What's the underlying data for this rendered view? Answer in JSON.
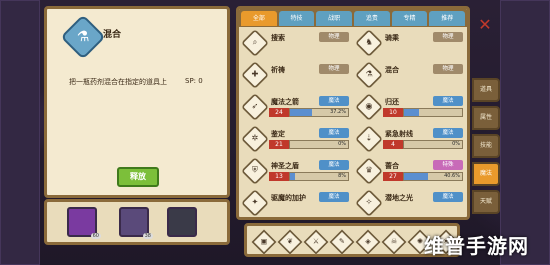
{
  "detail": {
    "title": "混合",
    "icon": "flask-icon",
    "description": "把一瓶药剂混合在指定的道具上",
    "sp": "SP: 0",
    "release_label": "释放"
  },
  "slots": [
    {
      "badge": "60",
      "color": "#7a3aa0"
    },
    {
      "badge": "38",
      "color": "#5a4a7a"
    },
    {
      "badge": "",
      "color": "#3a3a48"
    }
  ],
  "tabs": [
    "全部",
    "特技",
    "战职",
    "追责",
    "专精",
    "推荐"
  ],
  "skills": [
    {
      "name": "搜索",
      "type": "物理",
      "type_class": "phys",
      "icon": "search-icon",
      "glyph": "⌕"
    },
    {
      "name": "骑乘",
      "type": "物理",
      "type_class": "phys",
      "icon": "horse-icon",
      "glyph": "♞"
    },
    {
      "name": "祈祷",
      "type": "物理",
      "type_class": "phys",
      "icon": "pray-icon",
      "glyph": "✚"
    },
    {
      "name": "混合",
      "type": "物理",
      "type_class": "phys",
      "icon": "flask-icon",
      "glyph": "⚗"
    },
    {
      "name": "魔法之箭",
      "type": "魔法",
      "type_class": "magic",
      "level": "24",
      "pct": "37.2%",
      "progress": 0.372,
      "icon": "arrow-icon",
      "glyph": "➶"
    },
    {
      "name": "归还",
      "type": "魔法",
      "type_class": "magic",
      "level": "10",
      "pct": "",
      "progress": 0.25,
      "icon": "portal-icon",
      "glyph": "◉"
    },
    {
      "name": "鉴定",
      "type": "魔法",
      "type_class": "magic",
      "level": "21",
      "pct": "0%",
      "progress": 0.0,
      "icon": "identify-icon",
      "glyph": "✲"
    },
    {
      "name": "紧急射线",
      "type": "魔法",
      "type_class": "magic",
      "level": "4",
      "pct": "0%",
      "progress": 0.0,
      "icon": "ray-icon",
      "glyph": "⇣"
    },
    {
      "name": "神圣之盾",
      "type": "魔法",
      "type_class": "magic",
      "level": "13",
      "pct": "8%",
      "progress": 0.08,
      "icon": "shield-icon",
      "glyph": "⛨"
    },
    {
      "name": "蔷合",
      "type": "特殊",
      "type_class": "holy",
      "level": "27",
      "pct": "40.6%",
      "progress": 0.406,
      "icon": "crown-icon",
      "glyph": "♛"
    },
    {
      "name": "驱魔的加护",
      "type": "魔法",
      "type_class": "magic",
      "icon": "ward-icon",
      "glyph": "✦"
    },
    {
      "name": "潜地之光",
      "type": "魔法",
      "type_class": "magic",
      "icon": "light-icon",
      "glyph": "✧"
    }
  ],
  "side_tabs": [
    {
      "label": "道具",
      "active": false
    },
    {
      "label": "属性",
      "active": false
    },
    {
      "label": "技能",
      "active": false
    },
    {
      "label": "魔法",
      "active": true
    },
    {
      "label": "天赋",
      "active": false
    }
  ],
  "actions": [
    {
      "icon": "slot-icon",
      "glyph": "▣"
    },
    {
      "icon": "leaf-icon",
      "glyph": "❦"
    },
    {
      "icon": "sword-icon",
      "glyph": "⚔"
    },
    {
      "icon": "bolt-icon",
      "glyph": "✎"
    },
    {
      "icon": "gem-icon",
      "glyph": "◈"
    },
    {
      "icon": "skull-icon",
      "glyph": "☠"
    },
    {
      "icon": "wolf-icon",
      "glyph": "✺"
    },
    {
      "icon": "sun-icon",
      "glyph": "☀"
    }
  ],
  "watermark": "维普手游网"
}
